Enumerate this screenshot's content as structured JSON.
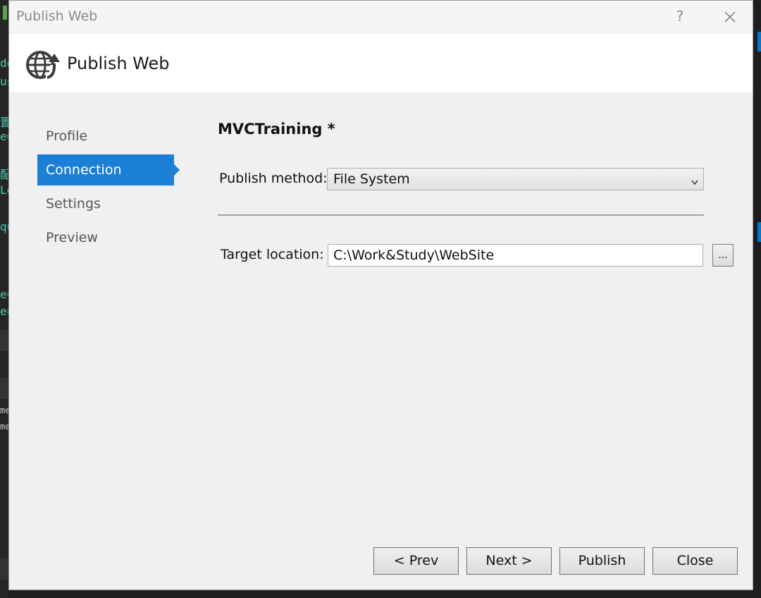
{
  "window": {
    "title": "Publish Web",
    "help_glyph": "?"
  },
  "header": {
    "title": "Publish Web",
    "icon": "globe-publish-icon"
  },
  "nav": {
    "items": [
      {
        "label": "Profile",
        "active": false
      },
      {
        "label": "Connection",
        "active": true
      },
      {
        "label": "Settings",
        "active": false
      },
      {
        "label": "Preview",
        "active": false
      }
    ]
  },
  "main": {
    "profile_name": "MVCTraining *",
    "publish_method": {
      "label": "Publish method:",
      "value": "File System"
    },
    "target_location": {
      "label": "Target location:",
      "value": "C:\\Work&Study\\WebSite",
      "browse_label": "..."
    }
  },
  "footer": {
    "prev_label": "< Prev",
    "next_label": "Next >",
    "publish_label": "Publish",
    "close_label": "Close"
  },
  "colors": {
    "accent": "#1c7fd6",
    "dialog_bg": "#f0f0f0",
    "header_bg": "#ffffff"
  }
}
